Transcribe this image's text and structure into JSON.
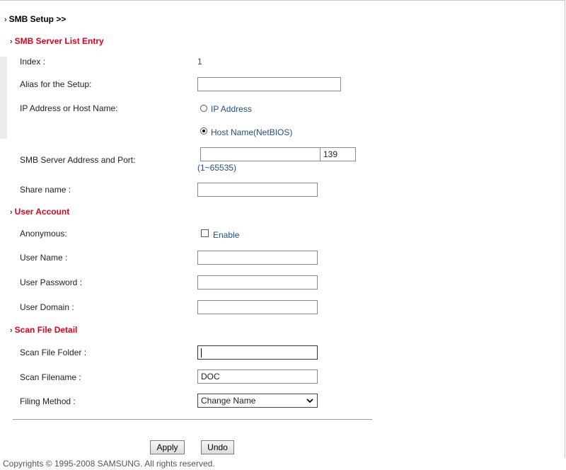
{
  "header": {
    "title": "SMB Setup >>"
  },
  "sections": {
    "server": "SMB Server List Entry",
    "user": "User Account",
    "scan": "Scan File Detail"
  },
  "labels": {
    "index": "Index :",
    "alias": "Alias for the Setup:",
    "ip_or_host": "IP Address or Host Name:",
    "smb_address_port": "SMB Server Address and Port:",
    "share_name": "Share name :",
    "anonymous": "Anonymous:",
    "user_name": "User Name :",
    "user_password": "User Password :",
    "user_domain": "User Domain :",
    "scan_folder": "Scan File Folder :",
    "scan_filename": "Scan Filename :",
    "filing_method": "Filing Method :"
  },
  "values": {
    "index": "1",
    "alias": "",
    "smb_address": "",
    "port": "139",
    "port_range": "(1~65535)",
    "share_name": "",
    "user_name": "",
    "user_password": "",
    "user_domain": "",
    "scan_folder": "",
    "scan_filename": "DOC",
    "filing_method": "Change Name"
  },
  "options": {
    "ip_address": "IP Address",
    "host_name": "Host Name(NetBIOS)",
    "selected": "host_name",
    "enable": "Enable",
    "enable_checked": false
  },
  "buttons": {
    "apply": "Apply",
    "undo": "Undo"
  },
  "footer": {
    "copyright": "Copyrights © 1995-2008 SAMSUNG. All rights reserved."
  },
  "colors": {
    "section": "#e3001b",
    "value_blue": "#1f4e8c",
    "chevron": "#1a3f8f"
  }
}
